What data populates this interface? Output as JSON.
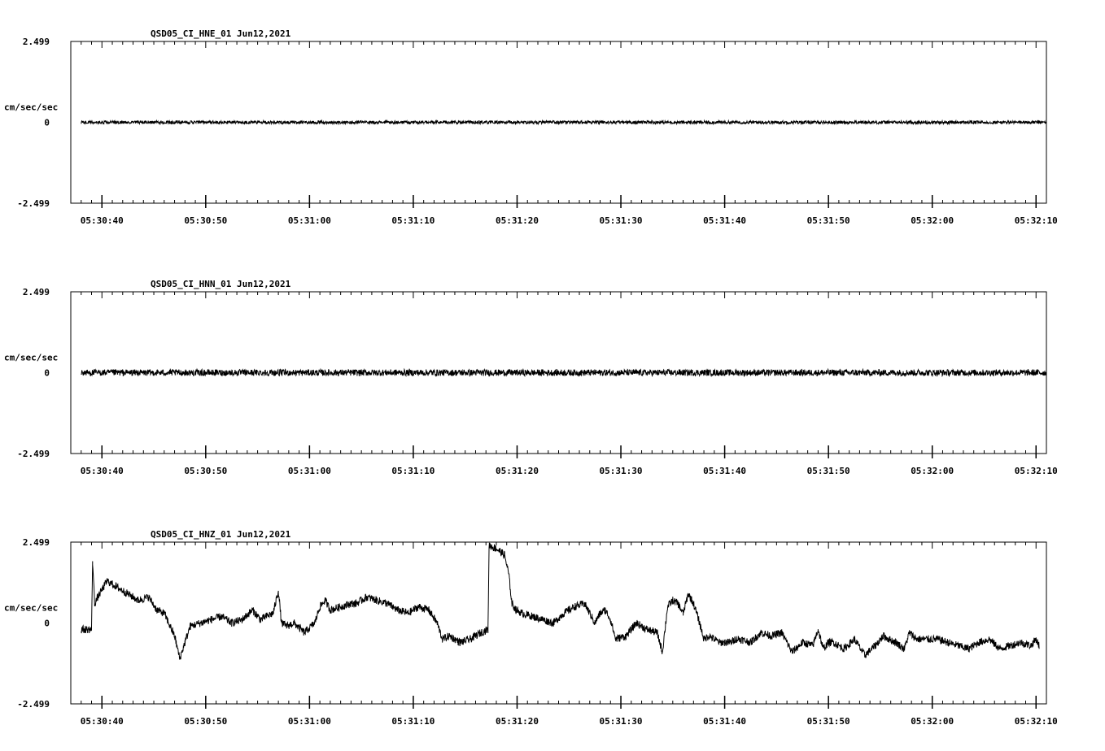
{
  "chart_data": [
    {
      "type": "line",
      "title": "QSD05_CI_HNE_01  Jun12,2021",
      "ylabel": "cm/sec/sec",
      "ylim": [
        -2.499,
        2.499
      ],
      "ytick_labels": [
        "2.499",
        "0",
        "-2.499"
      ],
      "xlim_seconds": [
        37.0,
        131.0
      ],
      "x_ticks_seconds": [
        40,
        50,
        60,
        70,
        80,
        90,
        100,
        110,
        120,
        130
      ],
      "x_tick_labels": [
        "05:30:40",
        "05:30:50",
        "05:31:00",
        "05:31:10",
        "05:31:20",
        "05:31:30",
        "05:31:40",
        "05:31:50",
        "05:32:00",
        "05:32:10"
      ],
      "grid": false,
      "line_color": "#000000",
      "series": [
        {
          "x": [
            38.0,
            131.0
          ],
          "y": [
            0.0,
            0.0
          ],
          "noise_amplitude": 0.05
        }
      ]
    },
    {
      "type": "line",
      "title": "QSD05_CI_HNN_01  Jun12,2021",
      "ylabel": "cm/sec/sec",
      "ylim": [
        -2.499,
        2.499
      ],
      "ytick_labels": [
        "2.499",
        "0",
        "-2.499"
      ],
      "xlim_seconds": [
        37.0,
        131.0
      ],
      "x_ticks_seconds": [
        40,
        50,
        60,
        70,
        80,
        90,
        100,
        110,
        120,
        130
      ],
      "x_tick_labels": [
        "05:30:40",
        "05:30:50",
        "05:31:00",
        "05:31:10",
        "05:31:20",
        "05:31:30",
        "05:31:40",
        "05:31:50",
        "05:32:00",
        "05:32:10"
      ],
      "grid": false,
      "line_color": "#000000",
      "series": [
        {
          "x": [
            38.0,
            131.0
          ],
          "y": [
            0.0,
            0.0
          ],
          "noise_amplitude": 0.1
        }
      ]
    },
    {
      "type": "line",
      "title": "QSD05_CI_HNZ_01  Jun12,2021",
      "ylabel": "cm/sec/sec",
      "ylim": [
        -2.499,
        2.499
      ],
      "ytick_labels": [
        "2.499",
        "0",
        "-2.499"
      ],
      "xlim_seconds": [
        37.0,
        131.0
      ],
      "x_ticks_seconds": [
        40,
        50,
        60,
        70,
        80,
        90,
        100,
        110,
        120,
        130
      ],
      "x_tick_labels": [
        "05:30:40",
        "05:30:50",
        "05:31:00",
        "05:31:10",
        "05:31:20",
        "05:31:30",
        "05:31:40",
        "05:31:50",
        "05:32:00",
        "05:32:10"
      ],
      "grid": false,
      "line_color": "#000000",
      "series": [
        {
          "x": [
            38.0,
            39.0,
            39.1,
            39.3,
            39.6,
            40.5,
            41.5,
            42.5,
            43.5,
            44.5,
            45.3,
            46.0,
            47.0,
            47.5,
            48.0,
            48.5,
            49.5,
            50.5,
            51.5,
            52.5,
            53.5,
            54.5,
            55.3,
            55.8,
            56.5,
            57.0,
            57.3,
            57.8,
            58.5,
            59.5,
            60.5,
            61.0,
            61.5,
            62.0,
            63.0,
            64.0,
            64.5,
            65.5,
            66.5,
            67.5,
            68.5,
            69.5,
            70.5,
            71.5,
            72.3,
            72.8,
            73.5,
            74.5,
            75.5,
            76.5,
            77.2,
            77.3,
            78.0,
            78.8,
            79.2,
            79.5,
            79.9,
            80.5,
            81.5,
            82.5,
            83.5,
            84.5,
            85.5,
            86.5,
            87.5,
            88.0,
            88.5,
            89.0,
            89.5,
            90.5,
            91.5,
            92.5,
            93.5,
            94.0,
            94.5,
            95.0,
            95.5,
            96.0,
            96.5,
            97.0,
            97.5,
            98.0,
            98.5,
            99.5,
            100.2,
            100.6,
            101.0,
            101.5,
            102.5,
            103.5,
            104.5,
            105.5,
            106.5,
            107.5,
            108.5,
            109.0,
            109.5,
            110.0,
            110.5,
            111.5,
            112.5,
            113.5,
            114.5,
            115.3,
            115.8,
            116.5,
            117.3,
            117.8,
            118.5,
            119.5,
            120.5,
            121.5,
            122.5,
            123.5,
            124.5,
            125.5,
            126.5,
            127.5,
            128.5,
            129.5,
            130.0,
            130.3
          ],
          "y": [
            -0.2,
            -0.2,
            1.9,
            0.6,
            0.8,
            1.3,
            1.1,
            0.9,
            0.7,
            0.8,
            0.4,
            0.3,
            -0.4,
            -1.1,
            -0.6,
            -0.1,
            0.0,
            0.1,
            0.2,
            0.0,
            0.1,
            0.4,
            0.1,
            0.2,
            0.3,
            1.0,
            0.0,
            -0.1,
            0.0,
            -0.3,
            0.0,
            0.5,
            0.7,
            0.4,
            0.5,
            0.6,
            0.6,
            0.8,
            0.7,
            0.6,
            0.4,
            0.3,
            0.5,
            0.4,
            0.0,
            -0.5,
            -0.4,
            -0.6,
            -0.5,
            -0.3,
            -0.2,
            2.4,
            2.3,
            2.1,
            1.5,
            0.6,
            0.4,
            0.3,
            0.2,
            0.1,
            0.0,
            0.3,
            0.5,
            0.6,
            0.0,
            0.3,
            0.4,
            0.1,
            -0.5,
            -0.4,
            0.0,
            -0.2,
            -0.3,
            -0.9,
            0.5,
            0.7,
            0.6,
            0.3,
            0.9,
            0.6,
            0.1,
            -0.5,
            -0.4,
            -0.6,
            -0.6,
            -0.6,
            -0.5,
            -0.5,
            -0.6,
            -0.3,
            -0.4,
            -0.3,
            -0.9,
            -0.6,
            -0.7,
            -0.2,
            -0.8,
            -0.6,
            -0.6,
            -0.8,
            -0.5,
            -1.0,
            -0.7,
            -0.4,
            -0.5,
            -0.6,
            -0.8,
            -0.3,
            -0.5,
            -0.5,
            -0.5,
            -0.6,
            -0.7,
            -0.8,
            -0.6,
            -0.5,
            -0.8,
            -0.7,
            -0.6,
            -0.7,
            -0.5,
            -0.7
          ]
        }
      ]
    }
  ]
}
